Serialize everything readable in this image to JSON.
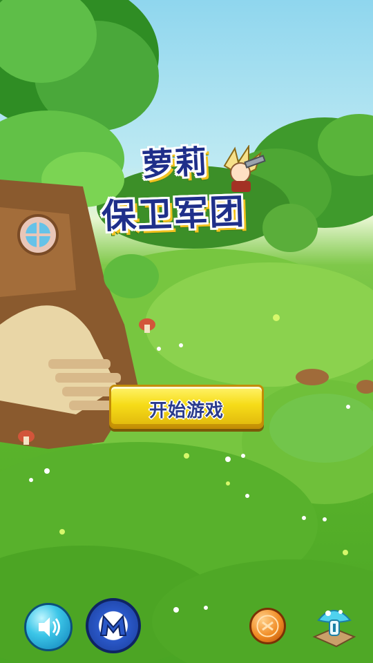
{
  "game": {
    "title_line1": "萝莉",
    "title_line2": "保卫军团",
    "start_label": "开始游戏"
  },
  "buttons": {
    "sound": {
      "icon": "speaker-icon"
    },
    "more": {
      "icon": "m-logo-icon"
    },
    "coin": {
      "icon": "coin-icon"
    },
    "info": {
      "icon": "info-mushroom-icon"
    }
  },
  "colors": {
    "sky": "#8fd6ee",
    "grass": "#5db62d",
    "title_text": "#1f2f8a",
    "button_yellow": "#f6dc18"
  }
}
